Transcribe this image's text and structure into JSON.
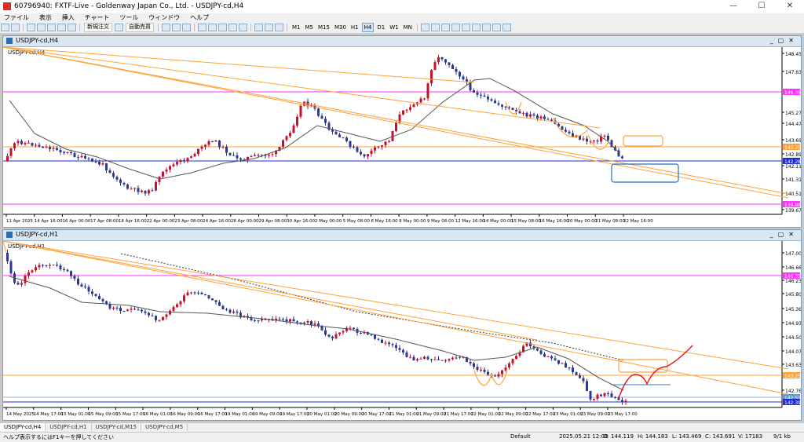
{
  "window_title": "60796940: FXTF-Live - Goldenway Japan Co., Ltd. - USDJPY-cd,H4",
  "window_controls": {
    "minimize": "—",
    "maximize": "☐",
    "close": "✕"
  },
  "menu": [
    "ファイル",
    "表示",
    "挿入",
    "チャート",
    "ツール",
    "ウィンドウ",
    "ヘルプ"
  ],
  "toolbar": {
    "new_order": "新規注文",
    "auto_trade": "自動売買",
    "timeframes": [
      "M1",
      "M5",
      "M15",
      "M30",
      "H1",
      "H4",
      "D1",
      "W1",
      "MN"
    ],
    "active_timeframe": "H4"
  },
  "chart_top": {
    "window_name": "USDJPY-cd,H4",
    "symbol_label": "USDJPY-cd,H4",
    "price_labels": [
      "148.450",
      "147.630",
      "146.357",
      "145.270",
      "144.470",
      "143.690",
      "143.256",
      "142.890",
      "142.286",
      "142.110",
      "141.310",
      "140.510",
      "139.883",
      "139.670"
    ],
    "highlight_labels": {
      "magenta_upper": "146.357",
      "orange": "143.256",
      "blue": "142.286",
      "magenta_lower": "139.883"
    },
    "time_labels": [
      "11 Apr 2025",
      "14 Apr 16:00",
      "16 Apr 00:00",
      "17 Apr 08:00",
      "18 Apr 16:00",
      "22 Apr 00:00",
      "23 Apr 08:00",
      "24 Apr 16:00",
      "28 Apr 00:00",
      "29 Apr 08:00",
      "30 Apr 16:00",
      "2 May 00:00",
      "5 May 08:00",
      "6 May 16:00",
      "8 May 00:00",
      "9 May 08:00",
      "12 May 16:00",
      "14 May 00:00",
      "15 May 08:00",
      "16 May 16:00",
      "20 May 00:00",
      "21 May 08:00",
      "22 May 16:00"
    ]
  },
  "chart_bottom": {
    "window_name": "USDJPY-cd,H1",
    "symbol_label": "USDJPY-cd,H1",
    "price_labels": [
      "147.000",
      "146.660",
      "146.357",
      "146.230",
      "145.800",
      "145.360",
      "144.930",
      "144.500",
      "144.070",
      "143.630",
      "143.256",
      "142.760",
      "142.526",
      "142.396"
    ],
    "highlight_labels": {
      "magenta": "146.357",
      "orange": "143.256",
      "light": "142.526",
      "blue": "142.396"
    },
    "time_labels": [
      "14 May 2025",
      "14 May 17:00",
      "15 May 01:00",
      "15 May 09:00",
      "15 May 17:00",
      "16 May 01:00",
      "16 May 09:00",
      "16 May 17:00",
      "19 May 01:00",
      "19 May 09:00",
      "19 May 17:00",
      "20 May 01:00",
      "20 May 09:00",
      "20 May 17:00",
      "21 May 01:00",
      "21 May 09:00",
      "21 May 17:00",
      "22 May 01:00",
      "22 May 09:00",
      "22 May 17:00",
      "23 May 01:00",
      "23 May 09:00",
      "23 May 17:00"
    ]
  },
  "tabs": [
    "USDJPY-cd,H4",
    "USDJPY-cd,H1",
    "USDJPY-cd,M15",
    "USDJPY-cd,M5"
  ],
  "active_tab": "USDJPY-cd,H4",
  "status": {
    "help": "ヘルプ表示するにはF1キーを押してください",
    "profile": "Default",
    "datetime": "2025.05.21 12:00",
    "open": "O: 144.119",
    "high": "H: 144.183",
    "low": "L: 143.469",
    "close": "C: 143.691",
    "volume": "V: 17183",
    "bandwidth": "9/1 kb"
  },
  "colors": {
    "bull_candle": "#c8102e",
    "bear_candle": "#2b3a8f",
    "magenta_line": "#ff33ff",
    "orange_line": "#ffa23a",
    "blue_line": "#1f2bd0",
    "ma_line": "#555555",
    "sketch_red": "#e8141b"
  }
}
